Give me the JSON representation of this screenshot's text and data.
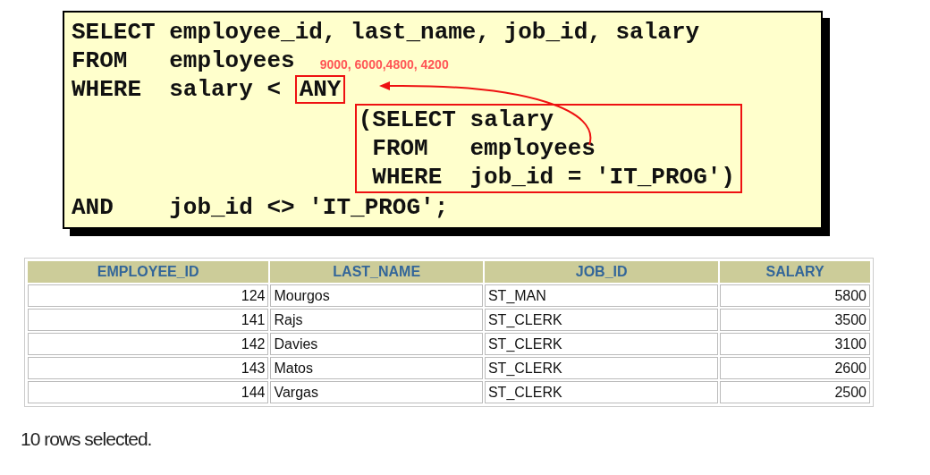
{
  "code_lines": [
    {
      "kind": "clause",
      "keyword": "SELECT",
      "text": "employee_id, last_name, job_id, salary"
    },
    {
      "kind": "clause",
      "keyword": "FROM",
      "text": "employees",
      "note": "9000, 6000,4800, 4200"
    },
    {
      "kind": "clause",
      "keyword": "WHERE",
      "text": "salary <",
      "boxed": "ANY"
    },
    {
      "kind": "subquery",
      "lines": [
        {
          "keyword": "(SELECT",
          "text": "salary"
        },
        {
          "keyword": "FROM",
          "text": "employees"
        },
        {
          "keyword": "WHERE",
          "text": "job_id = 'IT_PROG')"
        }
      ]
    },
    {
      "kind": "clause",
      "keyword": "AND",
      "text": "job_id <> 'IT_PROG';"
    }
  ],
  "table": {
    "columns": [
      "EMPLOYEE_ID",
      "LAST_NAME",
      "JOB_ID",
      "SALARY"
    ],
    "rows": [
      [
        "124",
        "Mourgos",
        "ST_MAN",
        "5800"
      ],
      [
        "141",
        "Rajs",
        "ST_CLERK",
        "3500"
      ],
      [
        "142",
        "Davies",
        "ST_CLERK",
        "3100"
      ],
      [
        "143",
        "Matos",
        "ST_CLERK",
        "2600"
      ],
      [
        "144",
        "Vargas",
        "ST_CLERK",
        "2500"
      ]
    ]
  },
  "status": "10 rows selected."
}
